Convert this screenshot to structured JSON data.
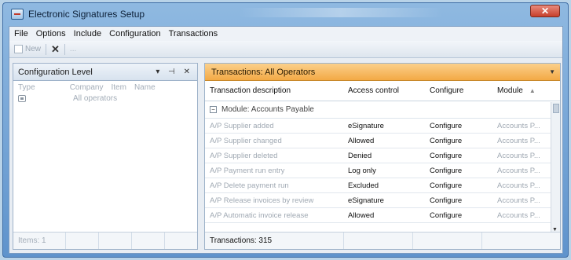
{
  "window": {
    "title": "Electronic Signatures Setup",
    "close_label": "✕"
  },
  "menu": [
    "File",
    "Options",
    "Include",
    "Configuration",
    "Transactions"
  ],
  "toolbar": {
    "new_label": "New",
    "delete_label": "✕",
    "disabled_label": "..."
  },
  "left_pane": {
    "title": "Configuration Level",
    "controls": "▾ ⊣ ✕",
    "columns": [
      "Type",
      "Company",
      "Item",
      "Name"
    ],
    "rows": [
      {
        "company": "All operators"
      }
    ],
    "footer": "Items: 1"
  },
  "right_pane": {
    "title": "Transactions: All Operators",
    "columns": [
      "Transaction description",
      "Access control",
      "Configure",
      "Module"
    ],
    "group": "Module: Accounts Payable",
    "rows": [
      {
        "description": "A/P Supplier added",
        "access": "eSignature",
        "configure": "Configure",
        "module": "Accounts P..."
      },
      {
        "description": "A/P Supplier changed",
        "access": "Allowed",
        "configure": "Configure",
        "module": "Accounts P..."
      },
      {
        "description": "A/P Supplier deleted",
        "access": "Denied",
        "configure": "Configure",
        "module": "Accounts P..."
      },
      {
        "description": "A/P Payment run entry",
        "access": "Log only",
        "configure": "Configure",
        "module": "Accounts P..."
      },
      {
        "description": "A/P Delete payment run",
        "access": "Excluded",
        "configure": "Configure",
        "module": "Accounts P..."
      },
      {
        "description": "A/P Release invoices by review",
        "access": "eSignature",
        "configure": "Configure",
        "module": "Accounts P..."
      },
      {
        "description": "A/P Automatic invoice release",
        "access": "Allowed",
        "configure": "Configure",
        "module": "Accounts P..."
      }
    ],
    "footer": "Transactions: 315"
  }
}
